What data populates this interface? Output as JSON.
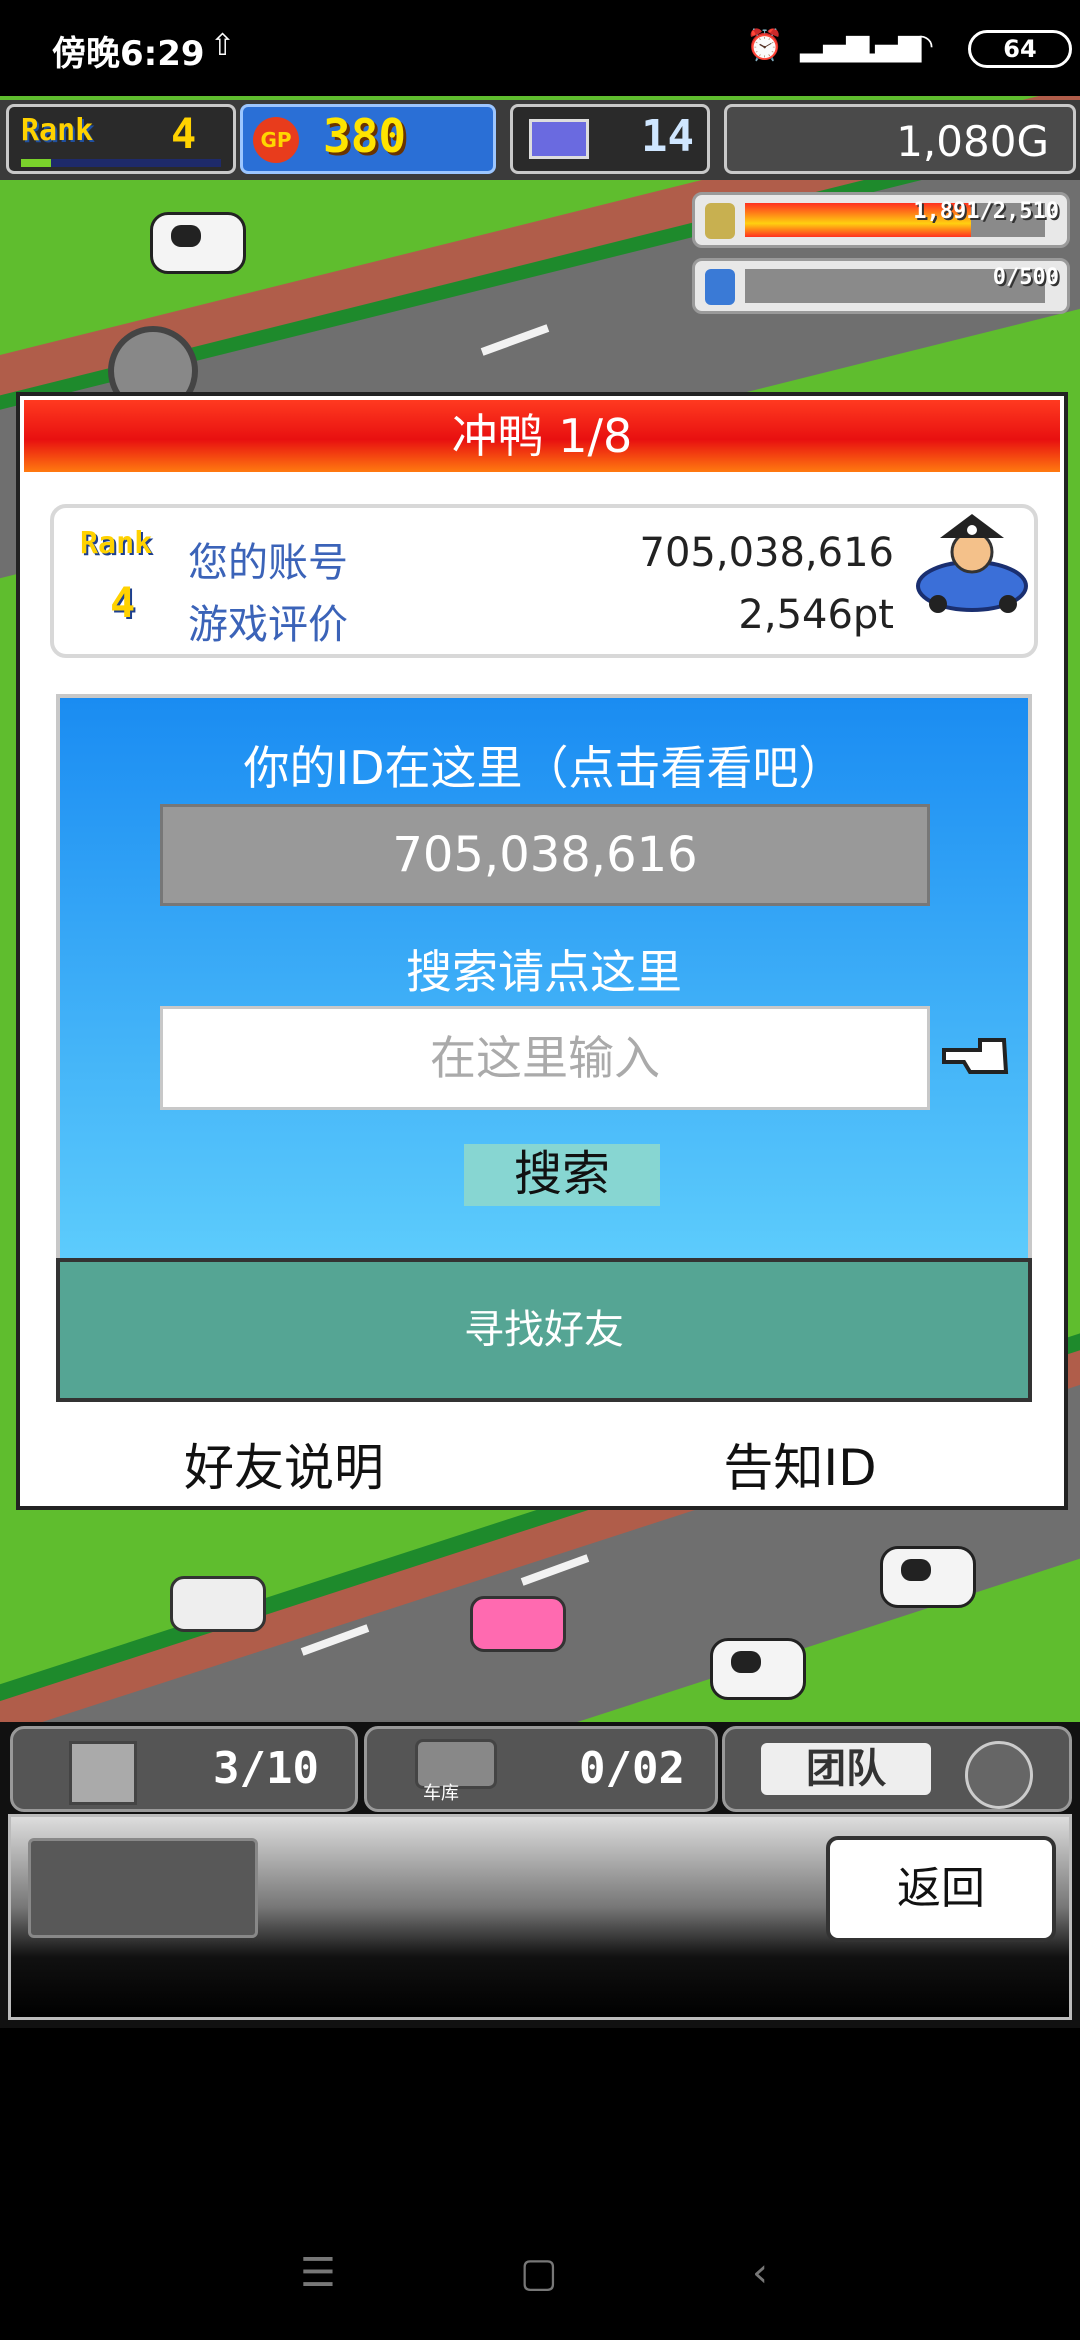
{
  "status_bar": {
    "time": "傍晚6:29",
    "battery": "64",
    "icons": [
      "upload-icon",
      "alarm-icon",
      "signal-icon",
      "hd-signal-icon",
      "wifi-icon",
      "battery-icon"
    ]
  },
  "hud": {
    "rank_label": "Rank",
    "rank_value": "4",
    "rank_progress": 0.15,
    "gp_icon_text": "GP",
    "gp_value": "380",
    "pc_value": "14",
    "gold": "1,080G"
  },
  "meters": [
    {
      "text": "1,891/2,510",
      "fill": 0.753,
      "icon_color": "#c8b050"
    },
    {
      "text": "0/500",
      "fill": 0.0,
      "icon_color": "#3a7ad6"
    }
  ],
  "dialog": {
    "title": "冲鸭 1/8",
    "user": {
      "rank_label": "Rank",
      "rank_value": "4",
      "account_label": "您的账号",
      "account_value": "705,038,616",
      "rating_label": "游戏评价",
      "rating_value": "2,546pt"
    },
    "id_label": "你的ID在这里（点击看看吧）",
    "id_value": "705,038,616",
    "search_label": "搜索请点这里",
    "search_placeholder": "在这里输入",
    "search_button": "搜索",
    "find_friend": "寻找好友",
    "friend_help": "好友说明",
    "notify_id": "告知ID"
  },
  "bottom": {
    "slot1_count": "3/10",
    "slot2_label": "车库",
    "slot2_count": "0/02",
    "slot3_label": "团队",
    "back": "返回"
  },
  "navbar": {
    "menu": "☰",
    "home": "▢",
    "back": "‹"
  }
}
